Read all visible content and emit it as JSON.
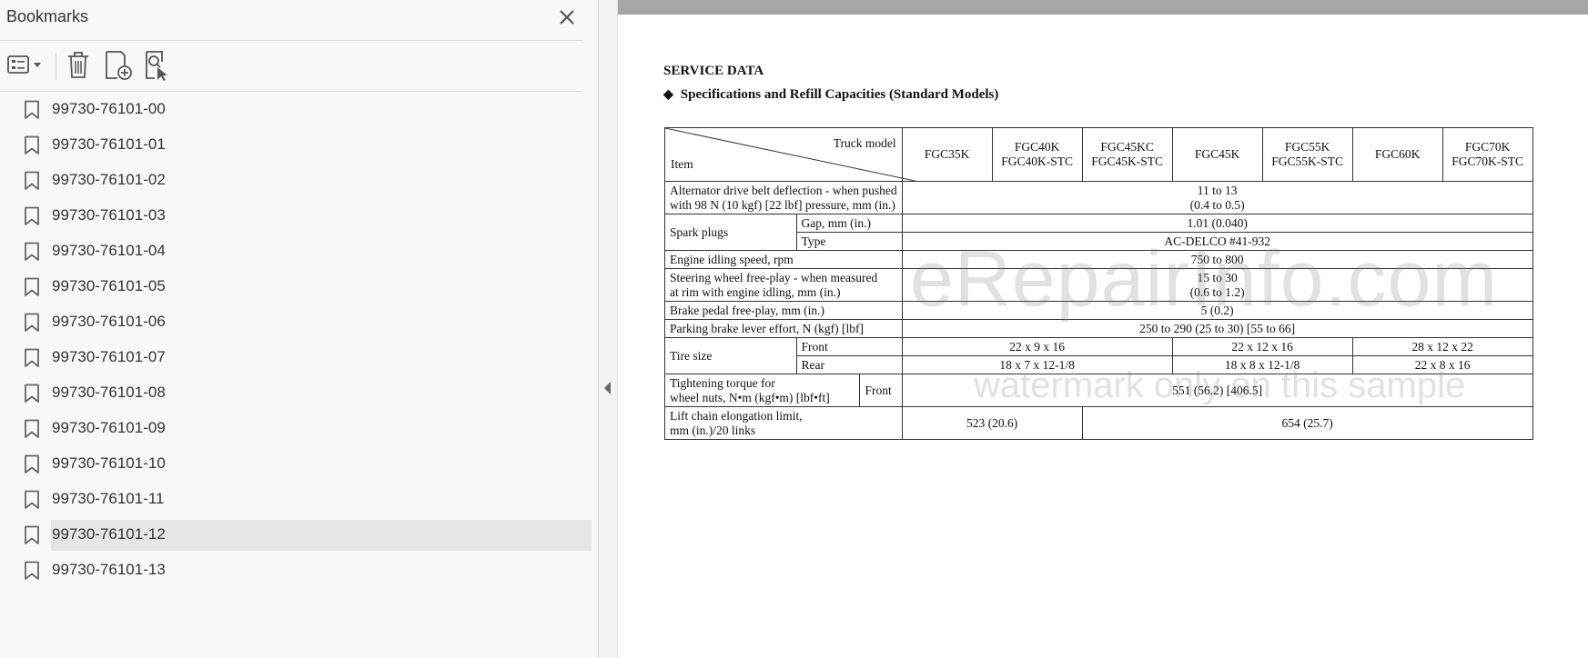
{
  "panel": {
    "title": "Bookmarks",
    "items": [
      {
        "label": "99730-76101-00"
      },
      {
        "label": "99730-76101-01"
      },
      {
        "label": "99730-76101-02"
      },
      {
        "label": "99730-76101-03"
      },
      {
        "label": "99730-76101-04"
      },
      {
        "label": "99730-76101-05"
      },
      {
        "label": "99730-76101-06"
      },
      {
        "label": "99730-76101-07"
      },
      {
        "label": "99730-76101-08"
      },
      {
        "label": "99730-76101-09"
      },
      {
        "label": "99730-76101-10"
      },
      {
        "label": "99730-76101-11"
      },
      {
        "label": "99730-76101-12",
        "selected": true
      },
      {
        "label": "99730-76101-13"
      }
    ]
  },
  "toolbar": {
    "options_icon": "list-options-icon",
    "delete_icon": "trash-icon",
    "add_icon": "add-bookmark-icon",
    "find_icon": "find-bookmark-icon"
  },
  "document": {
    "section": "SERVICE DATA",
    "subtitle": "Specifications and Refill Capacities (Standard Models)",
    "table": {
      "header_top": "Truck model",
      "header_bottom": "Item",
      "models": [
        [
          "FGC35K"
        ],
        [
          "FGC40K",
          "FGC40K-STC"
        ],
        [
          "FGC45KC",
          "FGC45K-STC"
        ],
        [
          "FGC45K"
        ],
        [
          "FGC55K",
          "FGC55K-STC"
        ],
        [
          "FGC60K"
        ],
        [
          "FGC70K",
          "FGC70K-STC"
        ]
      ],
      "alt_belt": {
        "label1": "Alternator drive belt deflection - when pushed",
        "label2": "with 98 N (10 kgf) [22 lbf] pressure, mm (in.)",
        "v1": "11 to 13",
        "v2": "(0.4 to 0.5)"
      },
      "spark": {
        "label": "Spark plugs",
        "gap_label": "Gap, mm (in.)",
        "gap": "1.01 (0.040)",
        "type_label": "Type",
        "type": "AC-DELCO #41-932"
      },
      "idle": {
        "label": "Engine idling speed, rpm",
        "value": "750 to 800"
      },
      "steer": {
        "label1": "Steering wheel free-play - when measured",
        "label2": "at rim with engine idling, mm (in.)",
        "v1": "15 to 30",
        "v2": "(0.6 to 1.2)"
      },
      "brake": {
        "label": "Brake pedal free-play, mm (in.)",
        "value": "5 (0.2)"
      },
      "parking": {
        "label": "Parking brake lever effort, N (kgf) [lbf]",
        "value": "250 to 290 (25 to 30) [55 to 66]"
      },
      "tire": {
        "label": "Tire size",
        "front_label": "Front",
        "rear_label": "Rear",
        "front": [
          "22 x 9 x 16",
          "22 x 12 x 16",
          "28 x 12 x 22"
        ],
        "rear": [
          "18 x 7 x 12-1/8",
          "18 x 8 x 12-1/8",
          "22 x 8 x 16"
        ]
      },
      "torque": {
        "label1": "Tightening torque for",
        "label2": "wheel nuts, N•m (kgf•m) [lbf•ft]",
        "sub": "Front",
        "value": "551 (56.2) [406.5]"
      },
      "chain": {
        "label1": "Lift chain elongation limit,",
        "label2": "mm (in.)/20 links",
        "v1": "523 (20.6)",
        "v2": "654 (25.7)"
      }
    }
  },
  "watermark": {
    "line1": "eRepairInfo.com",
    "line2": "watermark only on this sample"
  }
}
